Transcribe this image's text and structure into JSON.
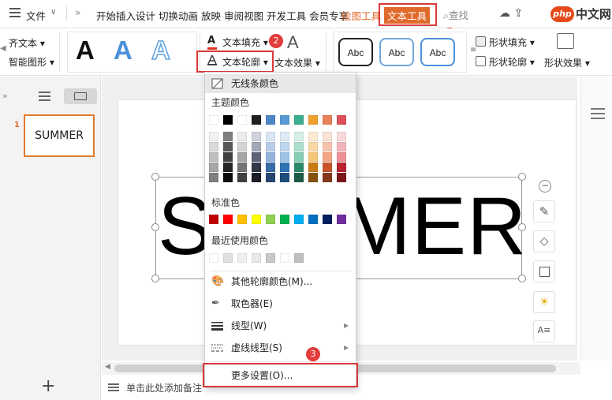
{
  "menubar": {
    "file_label": "文件",
    "more_symbol": "»",
    "tabs": [
      "开始",
      "插入",
      "设计",
      "切换",
      "动画",
      "放映",
      "审阅",
      "视图",
      "开发工具",
      "会员专享"
    ],
    "drawing_tools": "绘图工具",
    "text_tools": "文本工具",
    "search": "查找",
    "watermark_php": "php",
    "watermark_cn": "中文网"
  },
  "ribbon": {
    "align_text": "齐文本 ▾",
    "smart_shape": "智能图形 ▾",
    "text_fill": "文本填充 ▾",
    "text_outline": "文本轮廓 ▾",
    "text_effect": "文本效果 ▾",
    "style_letters": [
      "A",
      "A",
      "A"
    ],
    "shape_style_samples": [
      "Abc",
      "Abc",
      "Abc"
    ],
    "shape_fill": "形状填充 ▾",
    "shape_outline": "形状轮廓 ▾",
    "shape_effect": "形状效果 ▾"
  },
  "badges": [
    "1",
    "2",
    "3"
  ],
  "thumbnails": {
    "slide_number": "1",
    "slide_text": "SUMMER"
  },
  "slide": {
    "text": "SUMMER"
  },
  "notes": {
    "placeholder": "单击此处添加备注"
  },
  "dropdown": {
    "no_line": "无线条颜色",
    "theme_colors_label": "主题颜色",
    "standard_colors_label": "标准色",
    "recent_colors_label": "最近使用颜色",
    "more_colors": "其他轮廓颜色(M)...",
    "eyedropper": "取色器(E)",
    "line_type": "线型(W)",
    "dash_type": "虚线线型(S)",
    "more_settings": "更多设置(O)...",
    "theme_top_row": [
      "#ffffff",
      "#000000",
      "#ffffff",
      "#1f1f1f",
      "#4f86c6",
      "#5b9bd5",
      "#3cae8e",
      "#f0a030",
      "#e8815a",
      "#e0505a"
    ],
    "theme_columns": [
      [
        "#f2f2f2",
        "#d9d9d9",
        "#bfbfbf",
        "#a6a6a6",
        "#808080"
      ],
      [
        "#7f7f7f",
        "#595959",
        "#404040",
        "#262626",
        "#0d0d0d"
      ],
      [
        "#ececec",
        "#d4d4d4",
        "#a6a6a6",
        "#757575",
        "#404040"
      ],
      [
        "#d0d3db",
        "#a3a8b8",
        "#5c6378",
        "#323747",
        "#1a1d27"
      ],
      [
        "#dbe6f4",
        "#b8cde9",
        "#94b4de",
        "#3a6aa8",
        "#254670"
      ],
      [
        "#deebf7",
        "#bdd7ee",
        "#9dc3e6",
        "#2e75b6",
        "#1f4e79"
      ],
      [
        "#d5f0e6",
        "#acdfcd",
        "#84cfb4",
        "#2a8a6c",
        "#1c5c48"
      ],
      [
        "#fdecd2",
        "#fbd9a6",
        "#f8c679",
        "#c97b14",
        "#86520d"
      ],
      [
        "#fbe1d6",
        "#f7c3ad",
        "#f3a585",
        "#c9542a",
        "#86381c"
      ],
      [
        "#f9dadc",
        "#f3b5b9",
        "#ed9096",
        "#b8242e",
        "#7a181e"
      ]
    ],
    "standard_colors": [
      "#c00000",
      "#ff0000",
      "#ffc000",
      "#ffff00",
      "#92d050",
      "#00b050",
      "#00b0f0",
      "#0070c0",
      "#002060",
      "#7030a0"
    ],
    "recent_colors": [
      "#ffffff",
      "#e0e0e0",
      "#f0f0f0",
      "#e8e8e8",
      "#c8c8c8",
      "#ffffff",
      "#c0c0c0"
    ]
  }
}
